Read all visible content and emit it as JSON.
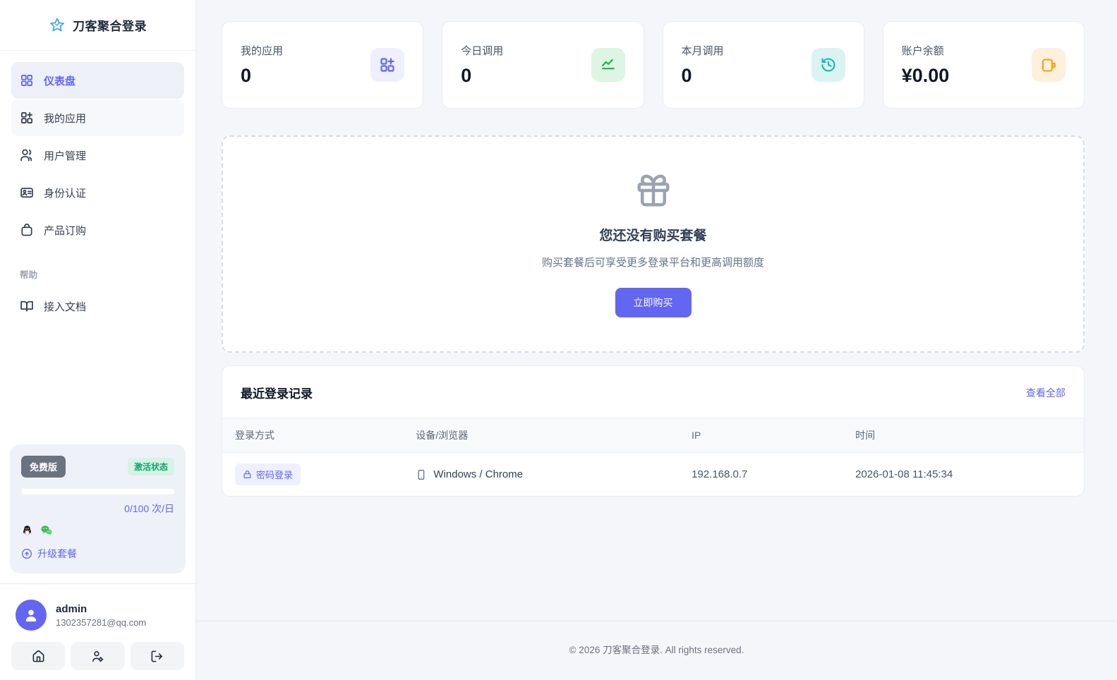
{
  "app": {
    "name": "刀客聚合登录"
  },
  "sidebar": {
    "nav": [
      {
        "label": "仪表盘"
      },
      {
        "label": "我的应用"
      },
      {
        "label": "用户管理"
      },
      {
        "label": "身份认证"
      },
      {
        "label": "产品订购"
      }
    ],
    "help_section_label": "帮助",
    "docs_label": "接入文档",
    "plan_card": {
      "plan_badge": "免费版",
      "status_badge": "激活状态",
      "quota_text": "0/100 次/日",
      "upgrade_label": "升级套餐"
    },
    "user": {
      "name": "admin",
      "email": "1302357281@qq.com"
    }
  },
  "stat_cards": [
    {
      "label": "我的应用",
      "value": "0",
      "icon": "grid-plus-icon",
      "color": "#6366f1"
    },
    {
      "label": "今日调用",
      "value": "0",
      "icon": "area-chart-icon",
      "color": "#1fb155"
    },
    {
      "label": "本月调用",
      "value": "0",
      "icon": "history-clock-icon",
      "color": "#14b8b0"
    },
    {
      "label": "账户余额",
      "value": "¥0.00",
      "icon": "wallet-icon",
      "color": "#f5a10c"
    }
  ],
  "package_empty": {
    "title": "您还没有购买套餐",
    "subtitle": "购买套餐后可享受更多登录平台和更高调用额度",
    "buy_button": "立即购买"
  },
  "recent_logins": {
    "title": "最近登录记录",
    "view_all": "查看全部",
    "columns": [
      "登录方式",
      "设备/浏览器",
      "IP",
      "时间"
    ],
    "rows": [
      {
        "method": "密码登录",
        "device": "Windows / Chrome",
        "ip": "192.168.0.7",
        "time": "2026-01-08 11:45:34"
      }
    ]
  },
  "footer": {
    "copyright": "© 2026 刀客聚合登录. All rights reserved."
  },
  "theme": {
    "accent": "#6366f1",
    "page_bg": "#f4f6fa",
    "sidebar_bg": "#ffffff",
    "status_green": "#0ea371",
    "stat_icon_colors": [
      "#6366f1",
      "#1fb155",
      "#14b8b0",
      "#f5a10c"
    ]
  }
}
